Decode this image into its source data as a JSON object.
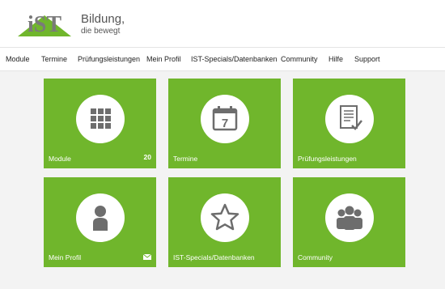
{
  "header": {
    "logo_text": "IST",
    "tagline_line1": "Bildung,",
    "tagline_line2": "die bewegt"
  },
  "nav": {
    "items": [
      "Module",
      "Termine",
      "Prüfungsleistungen",
      "Mein Profil",
      "IST-Specials/Datenbanken",
      "Community",
      "Hilfe",
      "Support"
    ]
  },
  "tiles": [
    {
      "label": "Module",
      "icon": "grid-icon",
      "count": "20"
    },
    {
      "label": "Termine",
      "icon": "calendar-icon",
      "day": "7"
    },
    {
      "label": "Prüfungsleistungen",
      "icon": "document-check-icon"
    },
    {
      "label": "Mein Profil",
      "icon": "person-icon",
      "badge_icon": "envelope-icon"
    },
    {
      "label": "IST-Specials/Datenbanken",
      "icon": "star-icon"
    },
    {
      "label": "Community",
      "icon": "group-icon"
    }
  ],
  "colors": {
    "tile": "#70b62c",
    "icon": "#6d6d6d",
    "logo_green": "#70b62c",
    "logo_gray": "#7a7a7a"
  }
}
